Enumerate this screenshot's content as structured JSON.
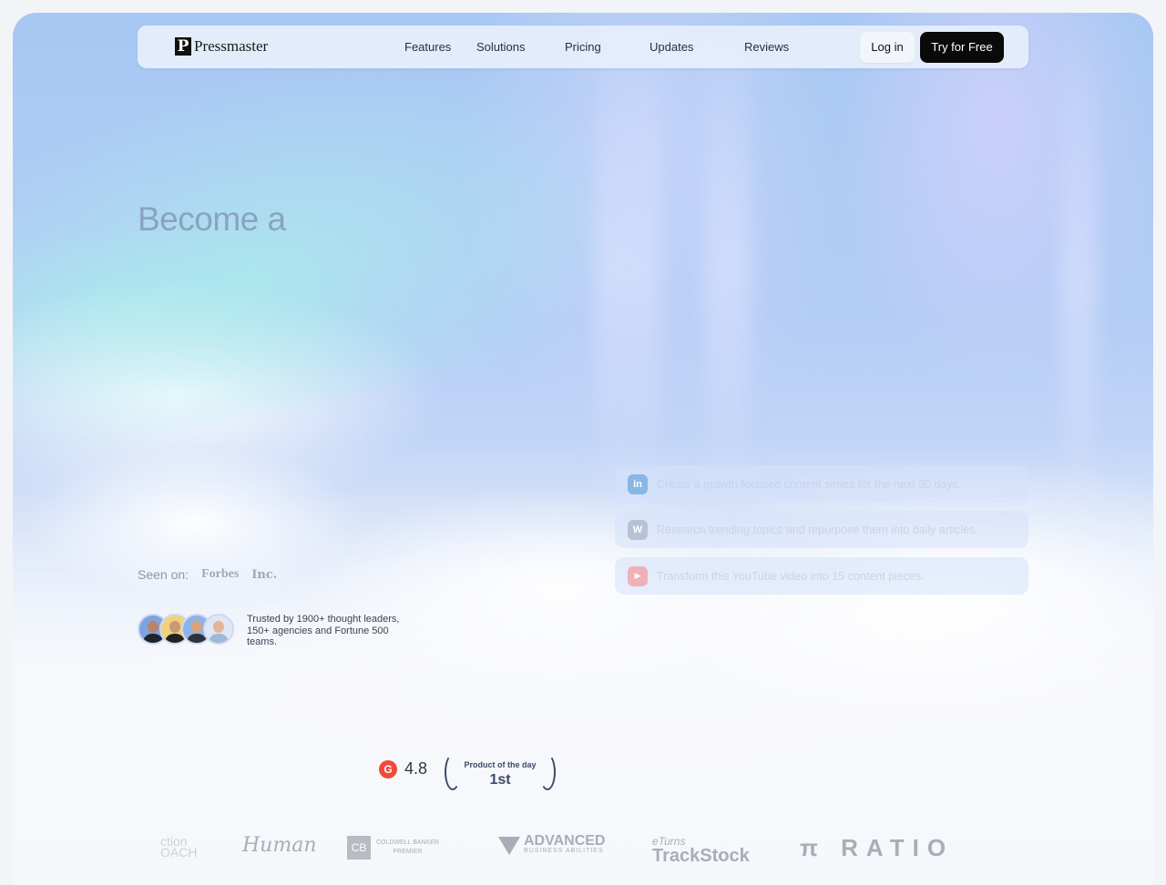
{
  "nav": {
    "brand": "Pressmaster",
    "brand_mark": "P",
    "links": [
      "Features",
      "Solutions",
      "Pricing",
      "Updates",
      "Reviews"
    ],
    "login": "Log in",
    "cta": "Try for Free"
  },
  "hero": {
    "title": "Become a"
  },
  "prompts": [
    {
      "icon": "linkedin-icon",
      "glyph": "in",
      "text": "Create a growth focused content series for the next 30 days."
    },
    {
      "icon": "wordpress-icon",
      "glyph": "W",
      "text": "Research trending topics and repurpose them into daily articles."
    },
    {
      "icon": "youtube-icon",
      "glyph": "▶",
      "text": "Transform this YouTube video into 15 content pieces."
    }
  ],
  "seen_on": {
    "label": "Seen on:",
    "outlets": [
      "Forbes",
      "Inc."
    ]
  },
  "trust": {
    "text": "Trusted by 1900+ thought leaders, 150+ agencies and Fortune 500 teams."
  },
  "rating": {
    "g2_glyph": "G",
    "score": "4.8",
    "award_line1": "Product of the day",
    "award_line2": "1st"
  },
  "client_logos": {
    "action_coach": [
      "ction",
      "OACH"
    ],
    "human": "Human",
    "coldwell": [
      "COLDWELL BANKER",
      "PREMIER"
    ],
    "advanced": [
      "ADVANCED",
      "BUSINESS ABILITIES"
    ],
    "trackstock": [
      "eTurns",
      "TrackStock"
    ],
    "ratio": "π RATIO"
  },
  "colors": {
    "accent": "#0a0a0a",
    "linkedin": "#86b7e6",
    "wordpress": "#b8c2d4",
    "youtube": "#f0b0b8",
    "g2": "#ef4a3a"
  }
}
